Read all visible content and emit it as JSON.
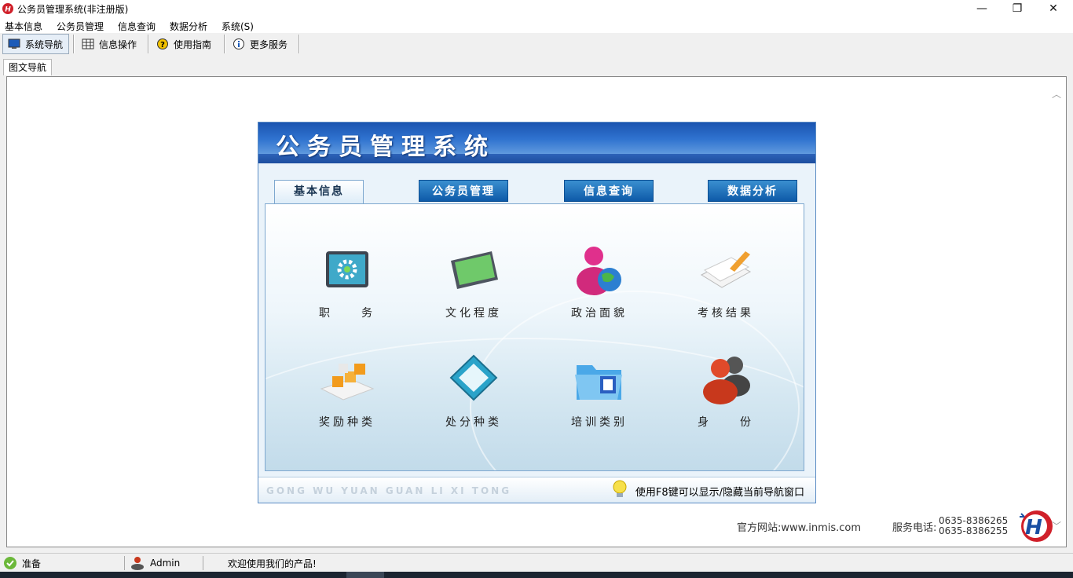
{
  "window": {
    "title": "公务员管理系统(非注册版)",
    "minimize": "—",
    "restore": "❐",
    "close": "✕"
  },
  "menu": [
    "基本信息",
    "公务员管理",
    "信息查询",
    "数据分析",
    "系统(S)"
  ],
  "toolbar": [
    "系统导航",
    "信息操作",
    "使用指南",
    "更多服务"
  ],
  "tab": "图文导航",
  "panel": {
    "title": "公务员管理系统",
    "categories": [
      "基本信息",
      "公务员管理",
      "信息查询",
      "数据分析"
    ],
    "items": [
      "职　　务",
      "文化程度",
      "政治面貌",
      "考核结果",
      "奖励种类",
      "处分种类",
      "培训类别",
      "身　　份"
    ],
    "footer_pinyin": "GONG WU YUAN GUAN LI XI TONG",
    "footer_tip": "使用F8键可以显示/隐藏当前导航窗口"
  },
  "contact": {
    "site": "官方网站:www.inmis.com",
    "phone_label": "服务电话:",
    "phone1": "0635-8386265",
    "phone2": "0635-8386255"
  },
  "status": {
    "ready": "准备",
    "user": "Admin",
    "welcome": "欢迎使用我们的产品!"
  },
  "colors": {
    "header_blue": "#1a54b0",
    "tab_blue": "#0e5aa8"
  }
}
